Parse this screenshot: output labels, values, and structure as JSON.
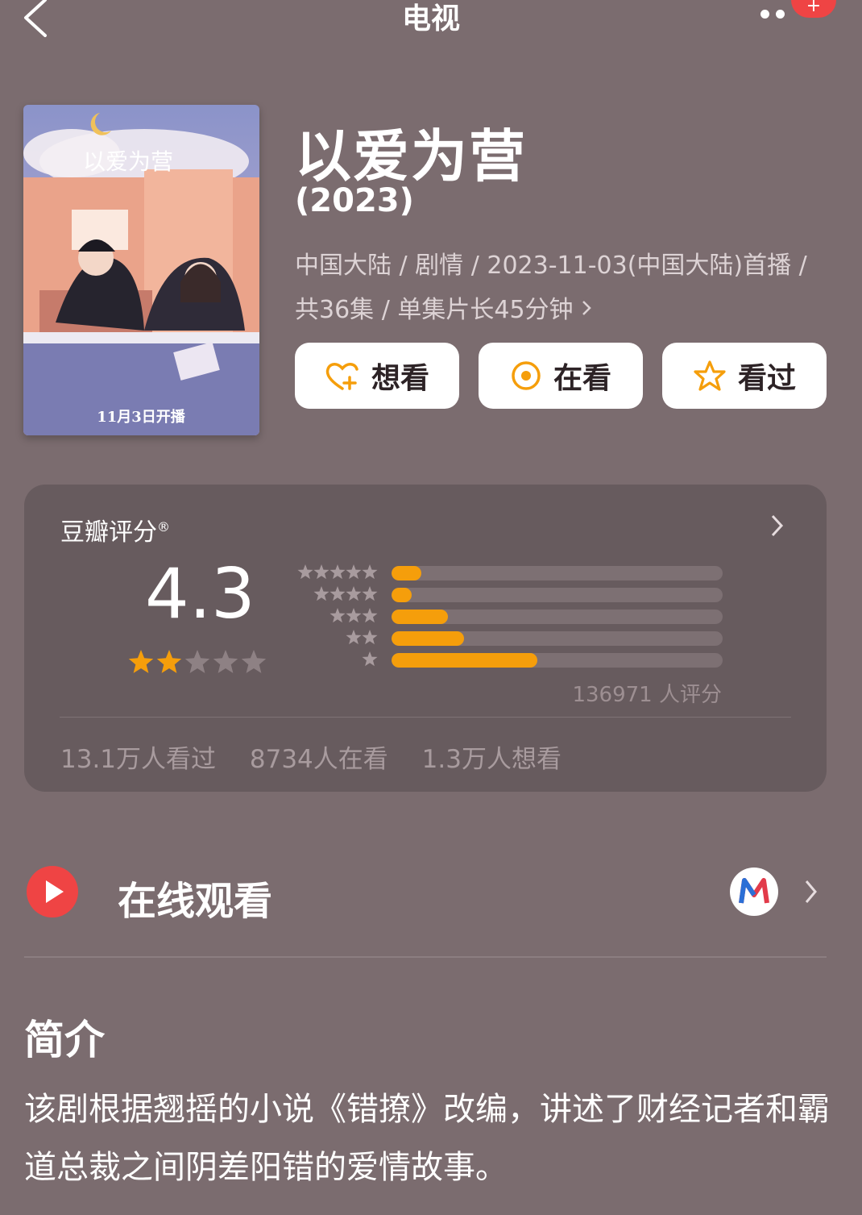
{
  "nav": {
    "title": "电视",
    "badge": "+"
  },
  "poster": {
    "title_text": "以爱为营",
    "caption": "11月3日开播"
  },
  "show": {
    "title": "以爱为营",
    "year": "(2023)",
    "meta": "中国大陆 / 剧情 / 2023-11-03(中国大陆)首播 / 共36集 / 单集片长45分钟"
  },
  "actions": [
    {
      "label": "想看",
      "icon": "heart-plus-icon"
    },
    {
      "label": "在看",
      "icon": "target-icon"
    },
    {
      "label": "看过",
      "icon": "star-outline-icon"
    }
  ],
  "rating": {
    "label": "豆瓣评分",
    "registered_mark": "®",
    "score": "4.3",
    "stars_filled": 2,
    "stars_total": 5,
    "distribution": [
      {
        "stars": 5,
        "fraction": 0.09
      },
      {
        "stars": 4,
        "fraction": 0.06
      },
      {
        "stars": 3,
        "fraction": 0.17
      },
      {
        "stars": 2,
        "fraction": 0.22
      },
      {
        "stars": 1,
        "fraction": 0.44
      }
    ],
    "raters": "136971 人评分",
    "watched": "13.1万人看过",
    "watching": "8734人在看",
    "want": "1.3万人想看"
  },
  "online": {
    "label": "在线观看",
    "platform_icon": "mango-tv-icon"
  },
  "intro": {
    "heading": "简介",
    "text": "该剧根据翘摇的小说《错撩》改编，讲述了财经记者和霸道总裁之间阴差阳错的爱情故事。"
  },
  "colors": {
    "background": "#7b6c6f",
    "accent": "#f59e0b",
    "red": "#ef4444"
  }
}
